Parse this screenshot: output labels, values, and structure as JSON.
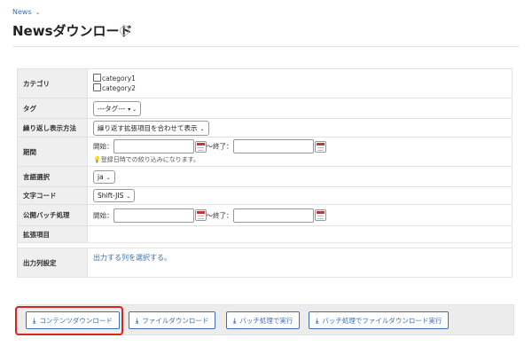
{
  "breadcrumb": {
    "label": "News",
    "chevron": "⌄"
  },
  "page": {
    "title": "Newsダウンロード",
    "help_icon": "?"
  },
  "form": {
    "category": {
      "label": "カテゴリ",
      "options": [
        "category1",
        "category2"
      ]
    },
    "tag": {
      "label": "タグ",
      "value": "---タグ---"
    },
    "repeat": {
      "label": "繰り返し表示方法",
      "value": "繰り返す拡張項目を合わせて表示"
    },
    "period": {
      "label": "期間",
      "start_label": "開始：",
      "end_label": "〜終了：",
      "note": "登録日時での絞り込みになります。"
    },
    "language": {
      "label": "言語選択",
      "value": "ja"
    },
    "encoding": {
      "label": "文字コード",
      "value": "Shift-JIS"
    },
    "batch": {
      "label": "公開バッチ処理",
      "start_label": "開始：",
      "end_label": "〜終了："
    },
    "extension": {
      "label": "拡張項目"
    },
    "output": {
      "label": "出力列設定",
      "link": "出力する列を選択する。"
    }
  },
  "buttons": {
    "content_download": "コンテンツダウンロード",
    "file_download": "ファイルダウンロード",
    "batch_run": "バッチ処理で実行",
    "batch_file_run": "バッチ処理でファイルダウンロード実行"
  },
  "colors": {
    "accent": "#3b6fb6",
    "highlight": "#d9261c",
    "label_bg": "#efefef"
  }
}
